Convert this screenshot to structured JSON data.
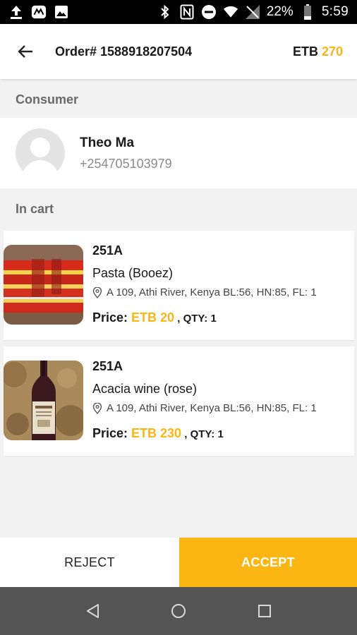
{
  "status_bar": {
    "battery": "22%",
    "time": "5:59"
  },
  "header": {
    "order_label": "Order# 1588918207504",
    "currency": "ETB",
    "total": "270"
  },
  "sections": {
    "consumer": "Consumer",
    "in_cart": "In cart"
  },
  "consumer": {
    "name": "Theo Ma",
    "phone": "+254705103979"
  },
  "cart": {
    "items": [
      {
        "code": "251A",
        "name": "Pasta (Booez)",
        "address": "A 109, Athi River, Kenya BL:56, HN:85, FL: 1",
        "price_label": "Price: ",
        "price": "ETB 20",
        "qty": " , QTY: 1"
      },
      {
        "code": "251A",
        "name": "Acacia wine (rose)",
        "address": "A 109, Athi River, Kenya BL:56, HN:85, FL: 1",
        "price_label": "Price: ",
        "price": "ETB 230",
        "qty": " , QTY: 1"
      }
    ]
  },
  "actions": {
    "reject": "REJECT",
    "accept": "ACCEPT"
  },
  "colors": {
    "accent": "#fbb614",
    "nav_bar": "#545454"
  },
  "icons": [
    "upload-icon",
    "app-icon",
    "image-icon",
    "bluetooth-icon",
    "nfc-icon",
    "dnd-icon",
    "wifi-icon",
    "signal-icon",
    "battery-icon",
    "back-arrow-icon",
    "location-pin-icon",
    "nav-back-icon",
    "nav-home-icon",
    "nav-recents-icon"
  ]
}
